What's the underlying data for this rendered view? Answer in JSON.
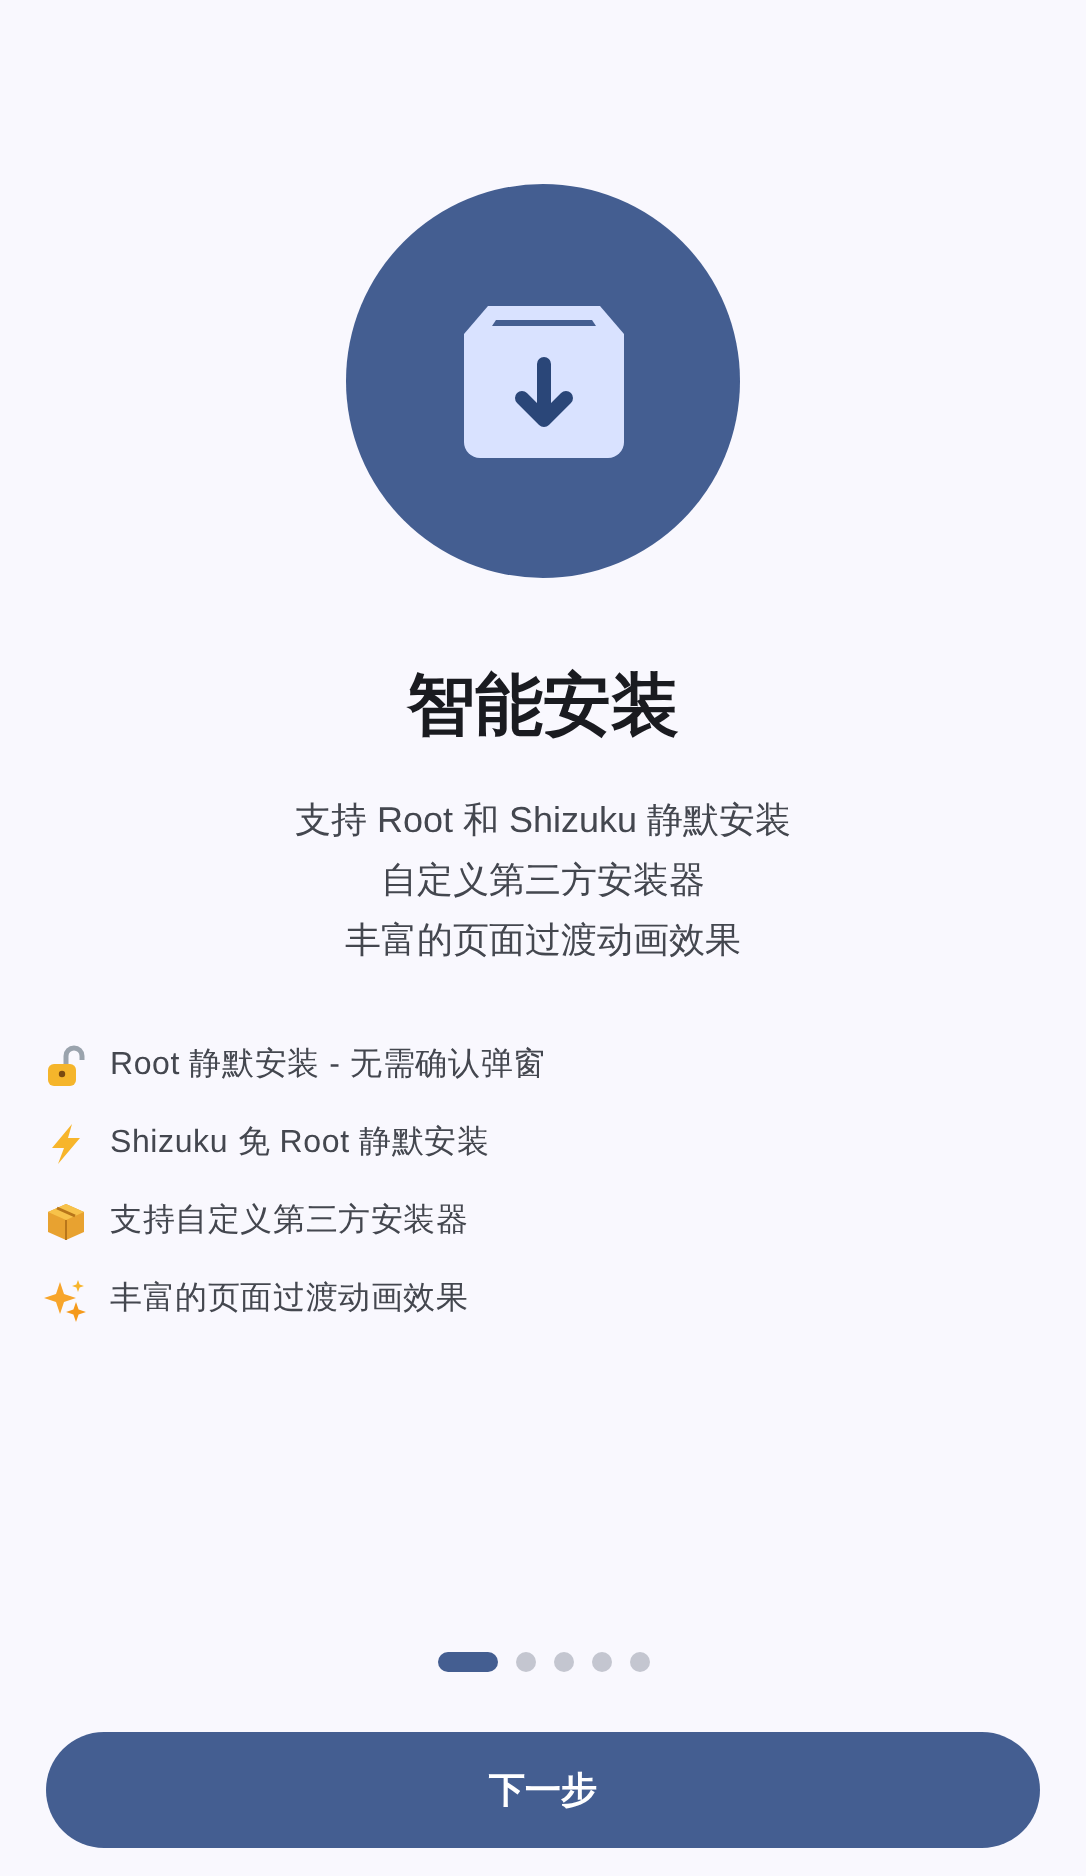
{
  "title": "智能安装",
  "description": [
    "支持 Root 和 Shizuku 静默安装",
    "自定义第三方安装器",
    "丰富的页面过渡动画效果"
  ],
  "features": [
    {
      "label": "Root 静默安装 - 无需确认弹窗"
    },
    {
      "label": "Shizuku 免 Root 静默安装"
    },
    {
      "label": "支持自定义第三方安装器"
    },
    {
      "label": "丰富的页面过渡动画效果"
    }
  ],
  "pages": [
    {
      "selected": true
    },
    {
      "selected": false
    },
    {
      "selected": false
    },
    {
      "selected": false
    },
    {
      "selected": false
    }
  ],
  "next_button": "下一步"
}
